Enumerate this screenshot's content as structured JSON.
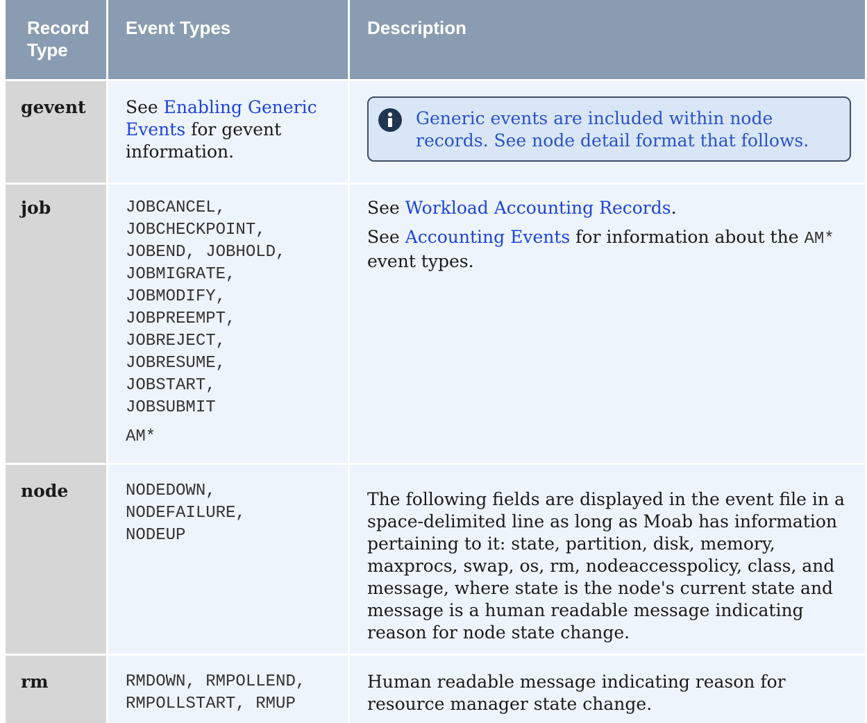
{
  "table": {
    "headers": {
      "record_type": "Record Type",
      "event_types": "Event Types",
      "description": "Description"
    },
    "rows": {
      "gevent": {
        "record_type": "gevent",
        "event_types": {
          "pre": "See ",
          "link": "Enabling Generic Events",
          "post": " for gevent information."
        },
        "note": {
          "icon": "info-icon",
          "text": "Generic events are included within node records. See node detail format that follows."
        }
      },
      "job": {
        "record_type": "job",
        "event_types": [
          "JOBCANCEL,",
          "JOBCHECKPOINT,",
          "JOBEND, JOBHOLD,",
          "JOBMIGRATE,",
          "JOBMODIFY,",
          "JOBPREEMPT,",
          "JOBREJECT,",
          "JOBRESUME,",
          "JOBSTART,",
          "JOBSUBMIT"
        ],
        "event_types_extra": "AM*",
        "description": {
          "line1_pre": "See ",
          "line1_link": "Workload Accounting Records",
          "line1_post": ".",
          "line2_pre": "See ",
          "line2_link": "Accounting Events",
          "line2_post": " for information about the ",
          "line2_code": "AM*",
          "line2_end": " event types."
        }
      },
      "node": {
        "record_type": "node",
        "event_types": [
          "NODEDOWN,",
          "NODEFAILURE,",
          "NODEUP"
        ],
        "description": "The following fields are displayed in the event file in a space-delimited line as long as Moab has information pertaining to it: state, partition, disk, memory, maxprocs, swap, os, rm, nodeaccesspolicy, class, and message, where state is the node's current state and message is a human readable message indicating reason for node state change."
      },
      "rm": {
        "record_type": "rm",
        "event_types": [
          "RMDOWN, RMPOLLEND,",
          "RMPOLLSTART, RMUP"
        ],
        "description": "Human readable message indicating reason for resource manager state change."
      }
    }
  },
  "colors": {
    "header_bg": "#8a9cb1",
    "record_col_bg": "#d6d6d6",
    "cell_bg": "#eef4fb",
    "link": "#1c44d8",
    "note_bg": "#d8e6f7",
    "note_border": "#3d4f66",
    "note_icon": "#1f3552"
  }
}
